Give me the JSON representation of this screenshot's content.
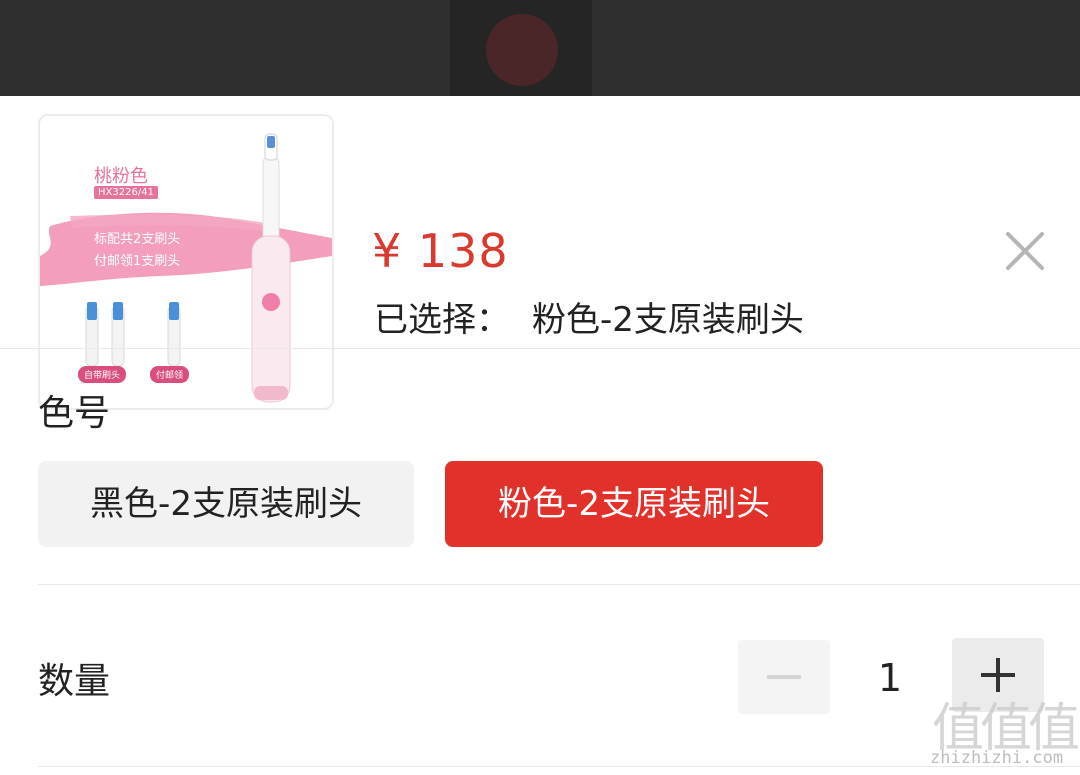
{
  "product": {
    "price": "¥ 138",
    "selected_label": "已选择：",
    "selected_value": "粉色-2支原装刷头",
    "thumbnail": {
      "title": "桃粉色",
      "model": "HX3226/41",
      "line1": "标配共2支刷头",
      "line2": "付邮领1支刷头",
      "tag1": "自带刷头",
      "tag2": "付邮领"
    }
  },
  "color_section": {
    "label": "色号",
    "options": [
      {
        "label": "黑色-2支原装刷头",
        "selected": false
      },
      {
        "label": "粉色-2支原装刷头",
        "selected": true
      }
    ]
  },
  "quantity_section": {
    "label": "数量",
    "value": "1"
  },
  "watermark": {
    "glyphs": "值值值",
    "text": "zhizhizhi.com"
  },
  "colors": {
    "accent": "#e2302a",
    "price": "#d9392e",
    "product_pink": "#e8739a"
  },
  "icons": {
    "close": "close-icon",
    "minus": "minus-icon",
    "plus": "plus-icon"
  }
}
